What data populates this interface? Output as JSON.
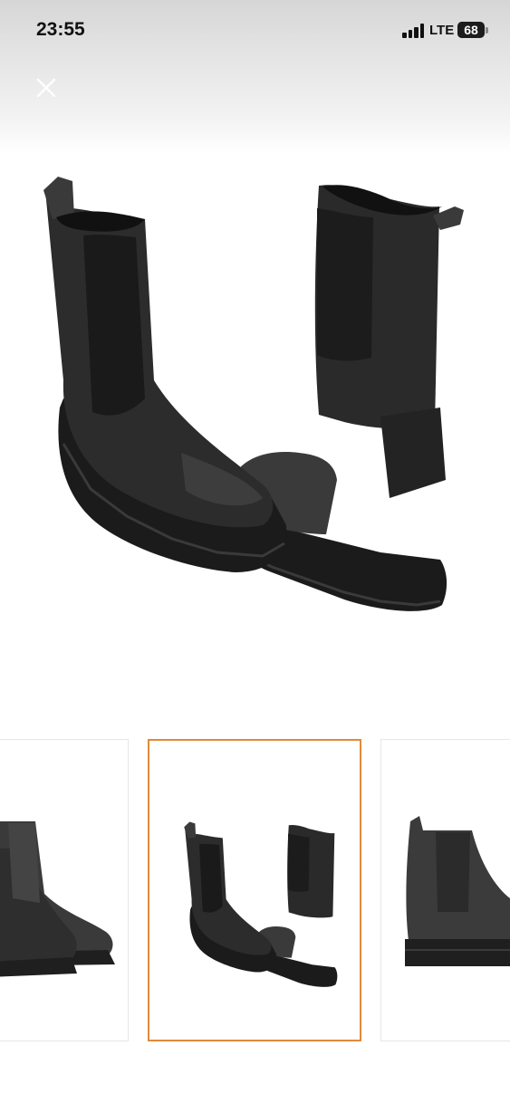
{
  "status_bar": {
    "time": "23:55",
    "network": "LTE",
    "battery": "68",
    "battery_level": 0.68,
    "signal_icon": "cellular-signal-icon"
  },
  "viewer": {
    "close_icon": "close-icon",
    "main_image": "black-chelsea-boots-pair",
    "thumbnails": [
      {
        "image": "boots-front-closeup",
        "selected": false
      },
      {
        "image": "black-chelsea-boots-pair",
        "selected": true
      },
      {
        "image": "boot-side-view",
        "selected": false
      }
    ]
  },
  "colors": {
    "selection_border": "#e08a3a",
    "boot_leather": "#2b2b2b",
    "boot_sole": "#1e1e1e"
  }
}
